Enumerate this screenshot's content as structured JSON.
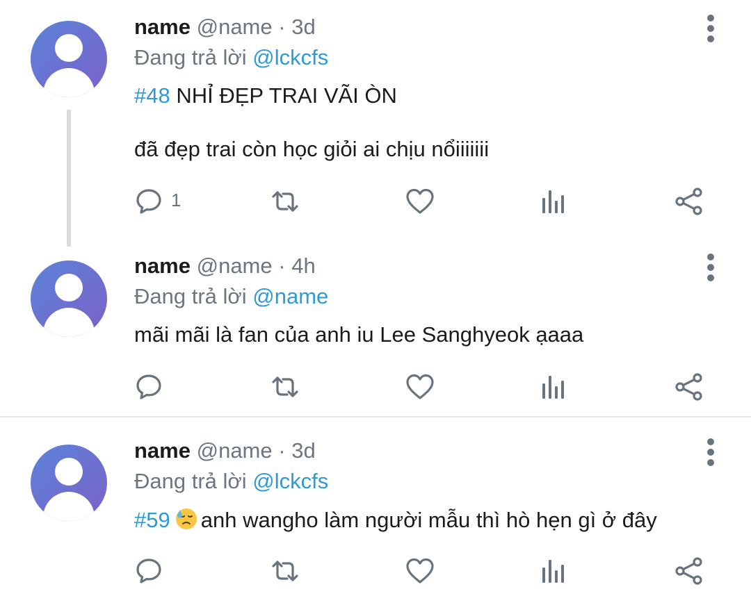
{
  "tweets": [
    {
      "name": "name",
      "handle": "@name",
      "dot": "·",
      "time": "3d",
      "reply_prefix": "Đang trả lời",
      "reply_to": "@lckcfs",
      "line1_hashtag": "#48",
      "line1_text": "NHỈ ĐẸP TRAI VÃI ÒN",
      "line2_text": "đã đẹp trai còn học giỏi ai chịu nổiiiiiii",
      "reply_count": "1"
    },
    {
      "name": "name",
      "handle": "@name",
      "dot": "·",
      "time": "4h",
      "reply_prefix": "Đang trả lời",
      "reply_to": "@name",
      "line1_text": "mãi mãi là fan của anh iu Lee Sanghyeok ạaaa"
    },
    {
      "name": "name",
      "handle": "@name",
      "dot": "·",
      "time": "3d",
      "reply_prefix": "Đang trả lời",
      "reply_to": "@lckcfs",
      "line1_hashtag": "#59",
      "emoji": "downcast-face-with-sweat",
      "line1_text": "anh wangho làm người mẫu thì hò hẹn gì ở đây"
    }
  ],
  "colors": {
    "link": "#2e9ad8",
    "muted": "#6b7680",
    "icon": "#68737d",
    "avatar": "#6d70cf"
  }
}
